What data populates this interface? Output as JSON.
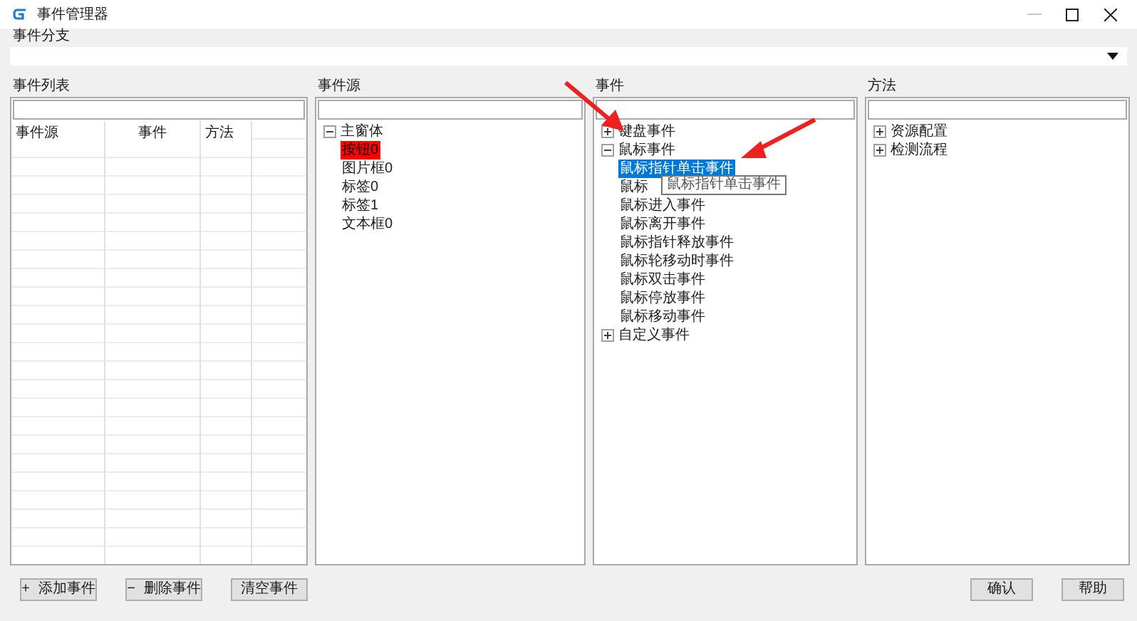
{
  "window": {
    "title": "事件管理器"
  },
  "branch": {
    "label": "事件分支"
  },
  "panels": [
    {
      "kind": "table",
      "label": "事件列表",
      "columns": [
        "事件源",
        "事件",
        "方法"
      ]
    },
    {
      "kind": "source",
      "label": "事件源",
      "tree": [
        {
          "label": "主窗体",
          "expanded": true,
          "selected": false,
          "children": [
            {
              "label": "按钮0",
              "selected": true
            },
            {
              "label": "图片框0",
              "selected": false
            },
            {
              "label": "标签0",
              "selected": false
            },
            {
              "label": "标签1",
              "selected": false
            },
            {
              "label": "文本框0",
              "selected": false
            }
          ]
        }
      ]
    },
    {
      "kind": "tree",
      "label": "事件",
      "tree": [
        {
          "label": "键盘事件",
          "expanded": false,
          "selected": false
        },
        {
          "label": "鼠标事件",
          "expanded": true,
          "selected": false,
          "children": [
            {
              "label": "鼠标指针单击事件",
              "selected": true
            },
            {
              "label": "鼠标",
              "selected": false
            },
            {
              "label": "鼠标进入事件",
              "selected": false
            },
            {
              "label": "鼠标离开事件",
              "selected": false
            },
            {
              "label": "鼠标指针释放事件",
              "selected": false
            },
            {
              "label": "鼠标轮移动时事件",
              "selected": false
            },
            {
              "label": "鼠标双击事件",
              "selected": false
            },
            {
              "label": "鼠标停放事件",
              "selected": false
            },
            {
              "label": "鼠标移动事件",
              "selected": false
            }
          ]
        },
        {
          "label": "自定义事件",
          "expanded": false,
          "selected": false
        }
      ],
      "tooltip": {
        "text": "鼠标指针单击事件"
      }
    },
    {
      "kind": "tree",
      "label": "方法",
      "tree": [
        {
          "label": "资源配置",
          "expanded": false,
          "selected": false
        },
        {
          "label": "检测流程",
          "expanded": false,
          "selected": false
        }
      ]
    }
  ],
  "left_buttons": [
    {
      "icon": "+",
      "label": "添加事件"
    },
    {
      "icon": "−",
      "label": "删除事件"
    },
    {
      "label": "清空事件"
    }
  ],
  "right_buttons": [
    {
      "label": "确认"
    },
    {
      "label": "帮助"
    }
  ],
  "annotations": [
    {
      "kind": "arrow"
    },
    {
      "kind": "arrow"
    }
  ]
}
